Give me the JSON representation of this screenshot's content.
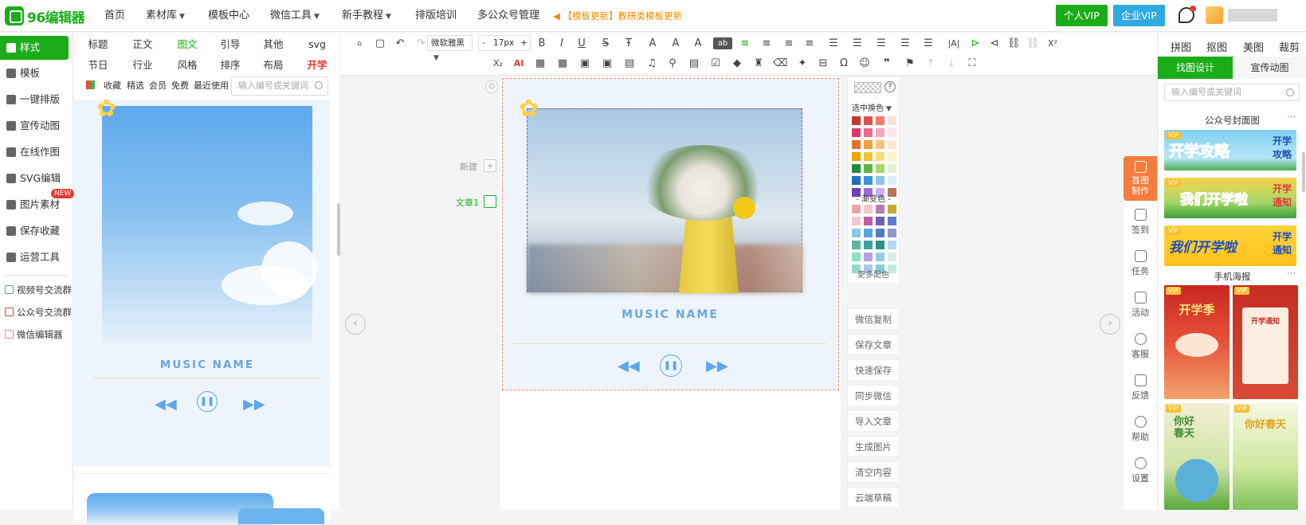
{
  "topbar": {
    "logo_text": "96编辑器",
    "nav": [
      {
        "label": "首页",
        "has_caret": false
      },
      {
        "label": "素材库",
        "has_caret": true
      },
      {
        "label": "模板中心",
        "has_caret": false
      },
      {
        "label": "微信工具",
        "has_caret": true
      },
      {
        "label": "新手教程",
        "has_caret": true
      },
      {
        "label": "排版培训",
        "has_caret": false
      },
      {
        "label": "多公众号管理",
        "has_caret": false
      }
    ],
    "notice": "【模板更新】教研类模板更新",
    "personal_vip": "个人VIP",
    "enterprise_vip": "企业VIP",
    "colors": {
      "brand": "#1aad19",
      "enterprise": "#2eaae0",
      "notice": "#f08c00"
    }
  },
  "left_nav": {
    "items": [
      {
        "label": "样式",
        "active": true,
        "icon": "grid-icon"
      },
      {
        "label": "模板",
        "active": false,
        "icon": "layers-icon"
      },
      {
        "label": "一键排版",
        "active": false,
        "icon": "brush-icon"
      },
      {
        "label": "宣传动图",
        "active": false,
        "icon": "gif-icon"
      },
      {
        "label": "在线作图",
        "active": false,
        "icon": "edit-icon"
      },
      {
        "label": "SVG编辑",
        "active": false,
        "icon": "cursor-icon"
      },
      {
        "label": "图片素材",
        "active": false,
        "icon": "image-icon"
      },
      {
        "label": "保存收藏",
        "active": false,
        "icon": "heart-icon"
      },
      {
        "label": "运营工具",
        "active": false,
        "icon": "apps-icon"
      }
    ],
    "new_badge": "NEW",
    "groups": [
      "视频号交流群",
      "公众号交流群",
      "微信编辑器"
    ]
  },
  "materials": {
    "categories_row1": [
      "标题",
      "正文",
      "图文",
      "引导",
      "其他",
      "svg"
    ],
    "categories_row2": [
      "节日",
      "行业",
      "风格",
      "排序",
      "布局",
      "开学"
    ],
    "active_category": "图文",
    "hot_category": "开学",
    "filters": [
      "收藏",
      "精选",
      "会员",
      "免费",
      "最近使用"
    ],
    "search_placeholder": "输入编号或关键词",
    "card_music_name": "MUSIC NAME"
  },
  "toolbar": {
    "font_family": "微软雅黑",
    "font_size": "17px",
    "size_minus": "-",
    "size_plus": "+",
    "buttons_row1": [
      "B",
      "I",
      "U",
      "S",
      "Ŧ",
      "A",
      "A",
      "A",
      "ab"
    ],
    "superscript": "X²",
    "subscript": "X₂",
    "ai": "AI"
  },
  "workspace": {
    "new_label": "新建",
    "article_label": "文章1",
    "music_name": "MUSIC NAME"
  },
  "color_panel": {
    "selected_label": "选中换色",
    "gradient_label": "- 渐变色 -",
    "more_label": "更多配色",
    "solid_colors": [
      "#c0392b",
      "#d9534f",
      "#ee7b6c",
      "#fbe0d9",
      "#d63b6d",
      "#e86a8e",
      "#f3a8bd",
      "#fbe3ea",
      "#e8702a",
      "#f39c3a",
      "#f7c37a",
      "#fde8cf",
      "#f0a500",
      "#f5c033",
      "#f9dc7a",
      "#fdf2c9",
      "#1e8e3e",
      "#5fb548",
      "#a6d96a",
      "#e1f3d2",
      "#1f6fbf",
      "#3d93e0",
      "#8cc4f1",
      "#dcecfa",
      "#6c3fb5",
      "#9b6fd6",
      "#c8b0ef",
      "#b5785c"
    ],
    "gradient_colors": [
      "#f0a3a8",
      "#f3c7c9",
      "#b57bb0",
      "#c9a830",
      "#f5c4d0",
      "#c35fa0",
      "#6e5fb5",
      "#5b7ecf",
      "#89c9e6",
      "#5aa4d8",
      "#4d7fc4",
      "#8a9ad6",
      "#5fb59c",
      "#3fa0a6",
      "#2f8f8a",
      "#b3d9ee",
      "#8ee0c8",
      "#b7a0e8",
      "#8fd0e6",
      "#d9f0e6",
      "#9ad7c8",
      "#aac6ef",
      "#89cdd8",
      "#c6e8da"
    ]
  },
  "actions": [
    "微信复制",
    "保存文章",
    "快速保存",
    "同步微信",
    "导入文章",
    "生成图片",
    "清空内容",
    "云端草稿"
  ],
  "right_panel": {
    "tabs": [
      "拼图",
      "抠图",
      "美图",
      "裁剪"
    ],
    "segments": [
      "找图设计",
      "宣传动图"
    ],
    "search_placeholder": "输入编号或关键词",
    "section_cover": "公众号封面图",
    "section_poster": "手机海报",
    "more": "···",
    "vip_tag": "VIP",
    "covers": [
      {
        "main": "开学攻略",
        "side": "开学攻略"
      },
      {
        "main": "我们开学啦",
        "side": "开学通知"
      },
      {
        "main": "我们开学啦",
        "side": "开学通知"
      }
    ],
    "posters": [
      "开学季",
      "开学通知",
      "你好春天",
      "你好春天"
    ]
  },
  "side_tools": [
    {
      "label": "首图制作",
      "active": true
    },
    {
      "label": "签到",
      "active": false
    },
    {
      "label": "任务",
      "active": false
    },
    {
      "label": "活动",
      "active": false
    },
    {
      "label": "客服",
      "active": false
    },
    {
      "label": "反馈",
      "active": false
    },
    {
      "label": "帮助",
      "active": false
    },
    {
      "label": "设置",
      "active": false
    }
  ]
}
